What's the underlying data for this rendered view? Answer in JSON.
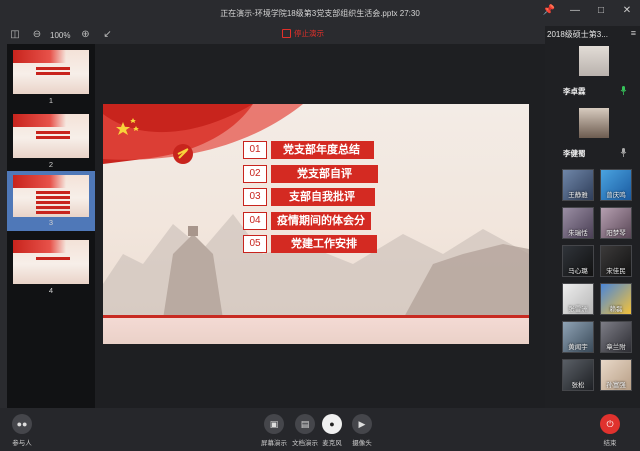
{
  "window": {
    "title": "正在演示-环境学院18级第3党支部组织生活会.pptx 27:30",
    "controls": [
      "pin-icon",
      "minimize-icon",
      "maximize-icon",
      "close-icon"
    ]
  },
  "toolbar": {
    "zoom_level": "100%",
    "stop_label": "停止演示"
  },
  "thumbnails": [
    {
      "number": "1"
    },
    {
      "number": "2"
    },
    {
      "number": "3",
      "selected": true
    },
    {
      "number": "4"
    }
  ],
  "slide": {
    "items": [
      {
        "num": "01",
        "label": "党支部年度总结"
      },
      {
        "num": "02",
        "label": "党支部自评"
      },
      {
        "num": "03",
        "label": "支部自我批评"
      },
      {
        "num": "04",
        "label": "疫情期间的体会分"
      },
      {
        "num": "05",
        "label": "党建工作安排"
      }
    ]
  },
  "participants": {
    "meeting_title": "2018级硕士第3...",
    "hosts": [
      {
        "name": "李卓霖"
      },
      {
        "name": "李健蜀"
      }
    ],
    "grid": [
      {
        "name": "王静雅"
      },
      {
        "name": "曾庆鸣"
      },
      {
        "name": "朱瑞恬"
      },
      {
        "name": "阳梦琴"
      },
      {
        "name": "马心璐"
      },
      {
        "name": "宋佳民"
      },
      {
        "name": "张雷洲"
      },
      {
        "name": "赖磊"
      },
      {
        "name": "黄闻宇"
      },
      {
        "name": "章兰附"
      },
      {
        "name": "张松"
      },
      {
        "name": "孙富强"
      }
    ]
  },
  "bottombar": {
    "participants_label": "参与人",
    "screen_share_label": "屏幕演示",
    "doc_share_label": "文档演示",
    "mic_label": "麦克风",
    "camera_label": "摄像头",
    "end_label": "结束"
  },
  "colors": {
    "accent_red": "#d42a22",
    "selected_blue": "#4f78b8",
    "end_red": "#e0322e"
  }
}
